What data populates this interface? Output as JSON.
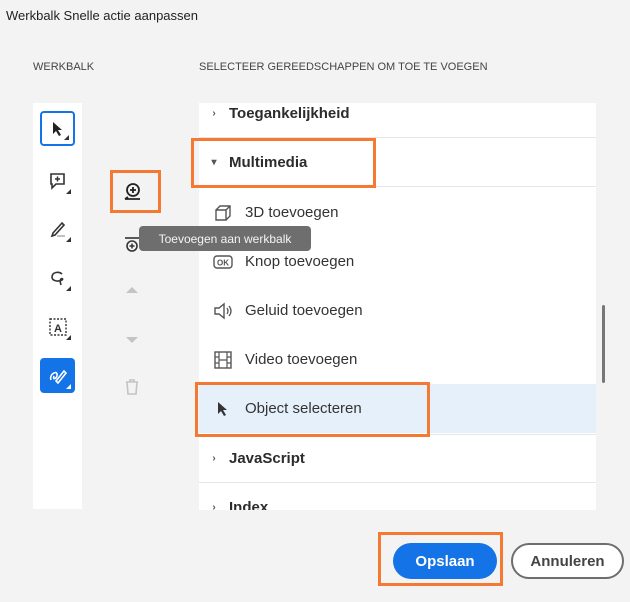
{
  "window_title": "Werkbalk Snelle actie aanpassen",
  "toolbar_header": "WERKBALK",
  "tools_header": "SELECTEER GEREEDSCHAPPEN OM TOE TE VOEGEN",
  "toolbar_tools": [
    {
      "name": "select-tool",
      "icon": "cursor-icon",
      "state": "selected"
    },
    {
      "name": "add-comment-tool",
      "icon": "comment-add-icon"
    },
    {
      "name": "highlight-tool",
      "icon": "pen-icon"
    },
    {
      "name": "draw-tool",
      "icon": "lasso-icon"
    },
    {
      "name": "text-select-tool",
      "icon": "text-box-icon"
    },
    {
      "name": "sign-tool",
      "icon": "signature-icon",
      "state": "active"
    }
  ],
  "tooltip": "Toevoegen aan werkbalk",
  "groups": {
    "accessibility": "Toegankelijkheid",
    "multimedia": "Multimedia",
    "javascript": "JavaScript",
    "index": "Index"
  },
  "multimedia_items": [
    {
      "label": "3D toevoegen",
      "icon": "cube-icon"
    },
    {
      "label": "Knop toevoegen",
      "icon": "ok-button-icon"
    },
    {
      "label": "Geluid toevoegen",
      "icon": "speaker-icon"
    },
    {
      "label": "Video toevoegen",
      "icon": "film-icon"
    },
    {
      "label": "Object selecteren",
      "icon": "cursor-icon",
      "selected": true
    }
  ],
  "buttons": {
    "save": "Opslaan",
    "cancel": "Annuleren"
  },
  "colors": {
    "accent": "#1473e6",
    "highlight": "#f47a33"
  }
}
